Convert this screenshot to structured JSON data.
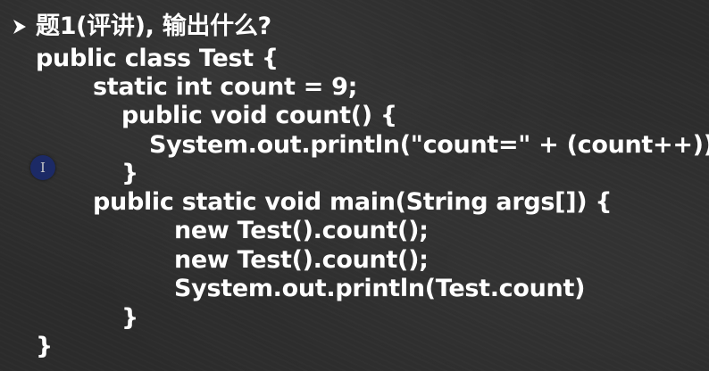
{
  "slide": {
    "title": "题1(评讲), 输出什么?",
    "bullet_icon": "arrow-bullet-icon",
    "code_lines": [
      "public class Test {",
      "static int count = 9;",
      "public void count() {",
      "System.out.println(\"count=\" + (count++));",
      "}",
      "public static void main(String args[]) {",
      "new Test().count();",
      "new Test().count();",
      "System.out.println(Test.count)",
      "}",
      "}"
    ]
  },
  "cursor": {
    "glyph": "I",
    "icon": "text-cursor-icon"
  },
  "colors": {
    "background": "#2b2b2b",
    "text": "#ffffff",
    "cursor_fill": "#1c2a66"
  }
}
